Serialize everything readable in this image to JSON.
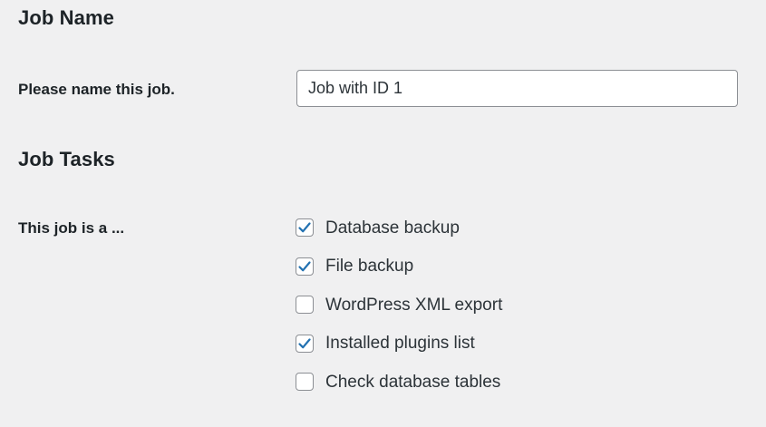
{
  "job_name_section": {
    "title": "Job Name",
    "field_label": "Please name this job.",
    "field_value": "Job with ID 1"
  },
  "job_tasks_section": {
    "title": "Job Tasks",
    "field_label": "This job is a ...",
    "tasks": [
      {
        "label": "Database backup",
        "checked": true
      },
      {
        "label": "File backup",
        "checked": true
      },
      {
        "label": "WordPress XML export",
        "checked": false
      },
      {
        "label": "Installed plugins list",
        "checked": true
      },
      {
        "label": "Check database tables",
        "checked": false
      }
    ]
  },
  "colors": {
    "background": "#f0f0f1",
    "checkmark": "#2271b1",
    "border": "#8c8f94"
  }
}
